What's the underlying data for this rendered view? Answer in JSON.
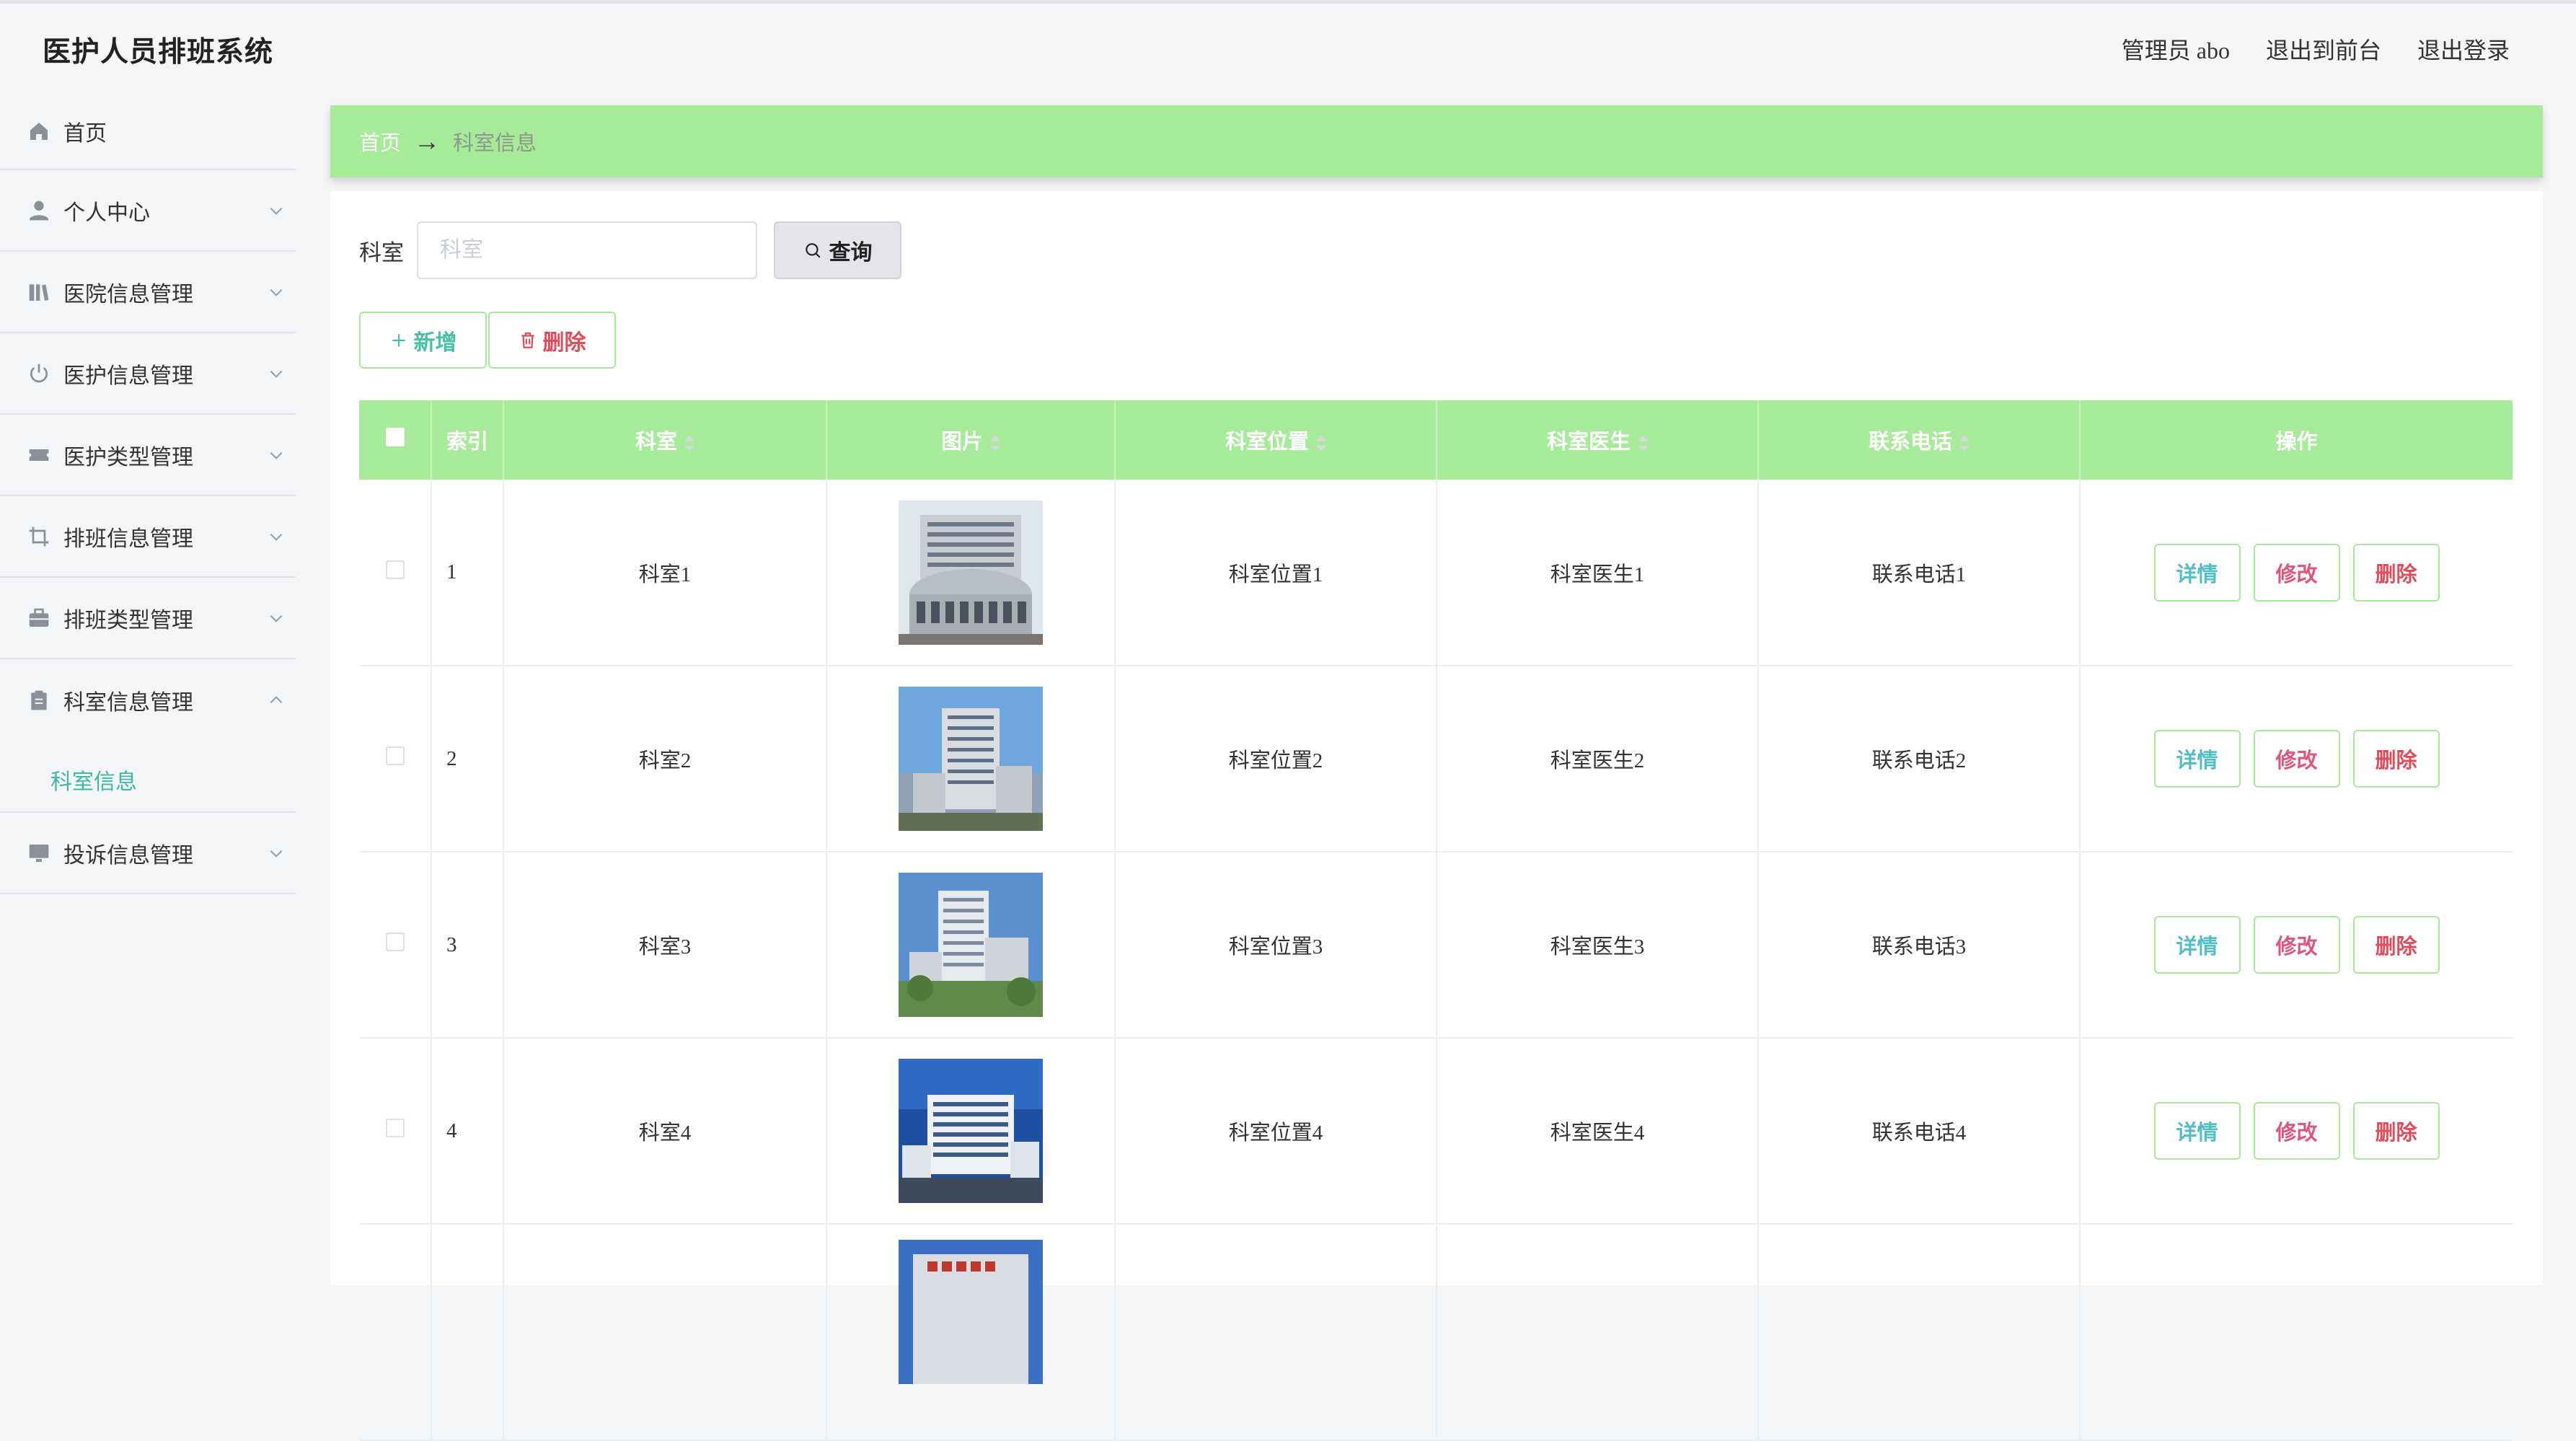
{
  "app": {
    "title": "医护人员排班系统"
  },
  "header": {
    "user": "管理员 abo",
    "to_front": "退出到前台",
    "logout": "退出登录"
  },
  "sidebar": {
    "items": [
      {
        "label": "首页",
        "icon": "home-icon"
      },
      {
        "label": "个人中心",
        "icon": "user-icon"
      },
      {
        "label": "医院信息管理",
        "icon": "books-icon"
      },
      {
        "label": "医护信息管理",
        "icon": "power-icon"
      },
      {
        "label": "医护类型管理",
        "icon": "ticket-icon"
      },
      {
        "label": "排班信息管理",
        "icon": "crop-icon"
      },
      {
        "label": "排班类型管理",
        "icon": "briefcase-icon"
      },
      {
        "label": "科室信息管理",
        "icon": "clipboard-icon",
        "expanded": true
      },
      {
        "label": "投诉信息管理",
        "icon": "monitor-icon"
      }
    ],
    "sub_active": "科室信息"
  },
  "breadcrumb": {
    "home": "首页",
    "sep": "→",
    "current": "科室信息"
  },
  "search": {
    "label": "科室",
    "placeholder": "科室",
    "button": "查询"
  },
  "actions": {
    "add": "新增",
    "delete": "删除"
  },
  "table": {
    "headers": {
      "index": "索引",
      "dept": "科室",
      "image": "图片",
      "location": "科室位置",
      "doctor": "科室医生",
      "phone": "联系电话",
      "ops": "操作"
    },
    "rows": [
      {
        "index": "1",
        "dept": "科室1",
        "location": "科室位置1",
        "doctor": "科室医生1",
        "phone": "联系电话1"
      },
      {
        "index": "2",
        "dept": "科室2",
        "location": "科室位置2",
        "doctor": "科室医生2",
        "phone": "联系电话2"
      },
      {
        "index": "3",
        "dept": "科室3",
        "location": "科室位置3",
        "doctor": "科室医生3",
        "phone": "联系电话3"
      },
      {
        "index": "4",
        "dept": "科室4",
        "location": "科室位置4",
        "doctor": "科室医生4",
        "phone": "联系电话4"
      }
    ],
    "row_ops": {
      "detail": "详情",
      "edit": "修改",
      "remove": "删除"
    }
  },
  "colors": {
    "accent_green": "#a7ea99",
    "teal": "#3cb9a0",
    "danger": "#e24c5a",
    "pink": "#e0567a"
  }
}
